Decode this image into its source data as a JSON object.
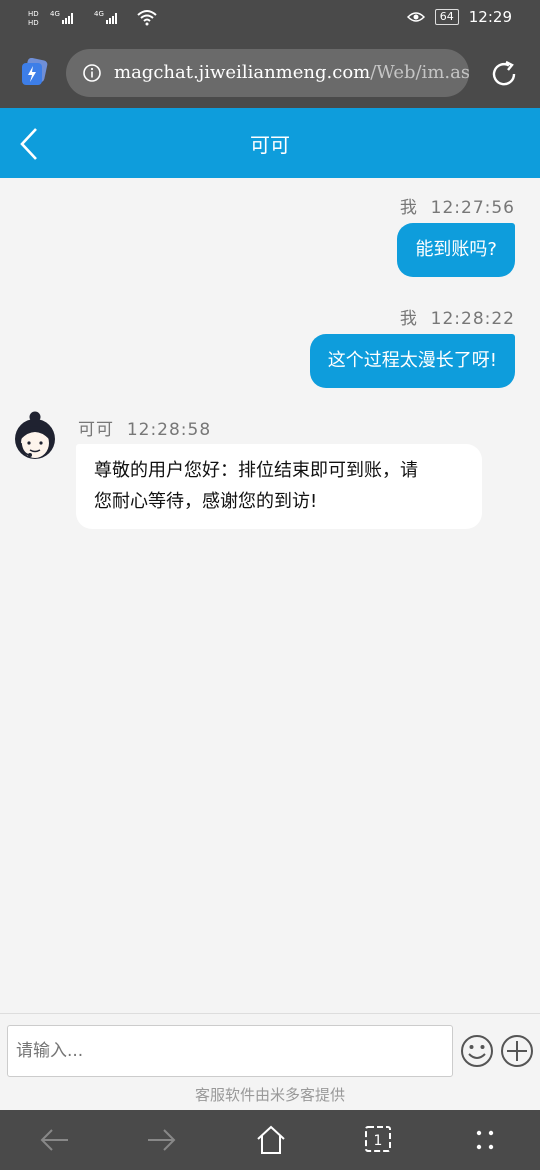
{
  "status": {
    "sim1": "HD 4G",
    "sim2": "HD 4G",
    "battery": "64",
    "time": "12:29"
  },
  "browser": {
    "url_main": "magchat.jiweilianmeng.com",
    "url_rest": "/Web/im.as"
  },
  "header": {
    "title": "可可"
  },
  "messages": [
    {
      "sender": "我",
      "time": "12:27:56",
      "text": "能到账吗?"
    },
    {
      "sender": "我",
      "time": "12:28:22",
      "text": "这个过程太漫长了呀!"
    },
    {
      "sender": "可可",
      "time": "12:28:58",
      "line1": "尊敬的用户您好：排位结束即可到账，请",
      "line2": "您耐心等待，感谢您的到访!"
    }
  ],
  "input": {
    "placeholder": "请输入..."
  },
  "footer": {
    "credit": "客服软件由米多客提供"
  },
  "colors": {
    "accent": "#0e9ddc",
    "chrome": "#4a4a4a"
  }
}
